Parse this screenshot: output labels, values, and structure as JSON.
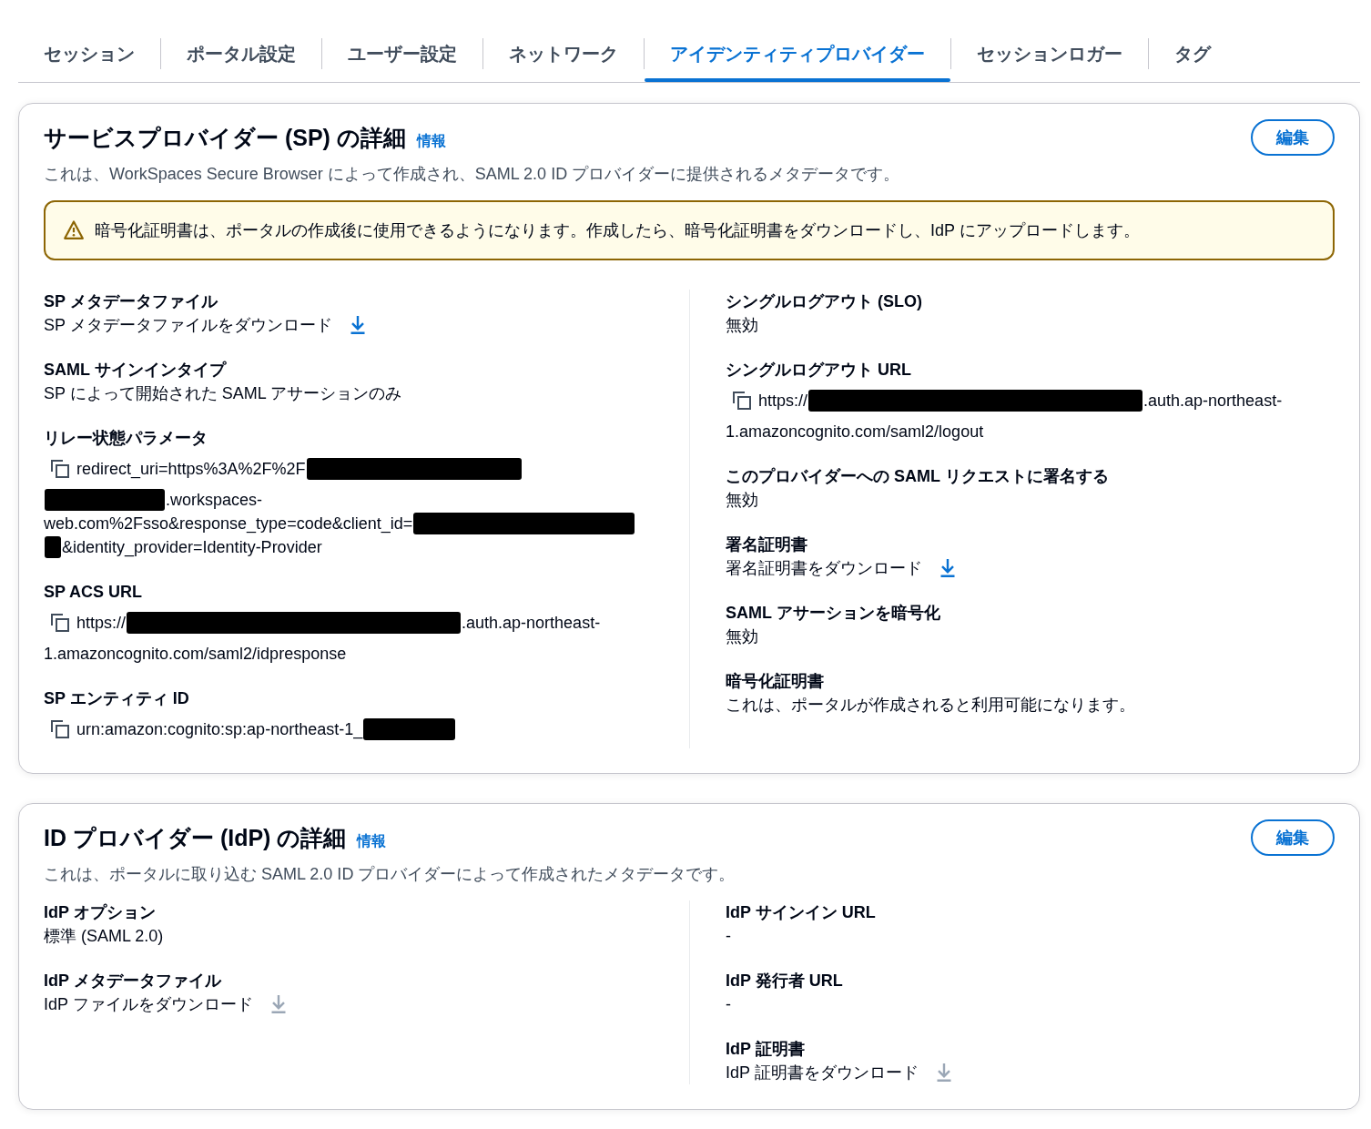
{
  "tabs": [
    {
      "label": "セッション",
      "selected": false
    },
    {
      "label": "ポータル設定",
      "selected": false
    },
    {
      "label": "ユーザー設定",
      "selected": false
    },
    {
      "label": "ネットワーク",
      "selected": false
    },
    {
      "label": "アイデンティティプロバイダー",
      "selected": true
    },
    {
      "label": "セッションロガー",
      "selected": false
    },
    {
      "label": "タグ",
      "selected": false
    }
  ],
  "sections": [
    {
      "title": "サービスプロバイダー (SP) の詳細",
      "info_link": "情報",
      "edit_button": "編集",
      "description": "これは、WorkSpaces Secure Browser によって作成され、SAML 2.0 ID プロバイダーに提供されるメタデータです。",
      "alert": {
        "text": "暗号化証明書は、ポータルの作成後に使用できるようになります。作成したら、暗号化証明書をダウンロードし、IdP にアップロードします。"
      },
      "columns": [
        [
          {
            "label": "SP メタデータファイル",
            "kind": "download",
            "value": "SP メタデータファイルをダウンロード",
            "disabled": false
          },
          {
            "label": "SAML サインインタイプ",
            "kind": "text",
            "value": "SP によって開始された SAML アサーションのみ"
          },
          {
            "label": "リレー状態パラメータ",
            "kind": "copy",
            "lines": [
              [
                {
                  "kind": "text",
                  "text": "redirect_uri=https%3A%2F%2F"
                },
                {
                  "kind": "redacted"
                }
              ],
              [
                {
                  "kind": "redacted"
                },
                {
                  "kind": "text",
                  "text": ".workspaces-"
                }
              ],
              [
                {
                  "kind": "text",
                  "text": "web.com%2Fsso&response_type=code&client_id="
                },
                {
                  "kind": "redacted"
                }
              ],
              [
                {
                  "kind": "redacted"
                },
                {
                  "kind": "text",
                  "text": "&identity_provider=Identity-Provider"
                }
              ]
            ]
          },
          {
            "label": "SP ACS URL",
            "kind": "copy",
            "lines": [
              [
                {
                  "kind": "text",
                  "text": "https://"
                },
                {
                  "kind": "redacted"
                },
                {
                  "kind": "text",
                  "text": ".auth.ap-northeast-"
                }
              ],
              [
                {
                  "kind": "text",
                  "text": "1.amazoncognito.com/saml2/idpresponse"
                }
              ]
            ]
          },
          {
            "label": "SP エンティティ ID",
            "kind": "copy",
            "lines": [
              [
                {
                  "kind": "text",
                  "text": "urn:amazon:cognito:sp:ap-northeast-1_"
                },
                {
                  "kind": "redacted"
                }
              ]
            ]
          }
        ],
        [
          {
            "label": "シングルログアウト (SLO)",
            "kind": "text",
            "value": "無効"
          },
          {
            "label": "シングルログアウト URL",
            "kind": "copy",
            "lines": [
              [
                {
                  "kind": "text",
                  "text": "https://"
                },
                {
                  "kind": "redacted"
                },
                {
                  "kind": "text",
                  "text": ".auth.ap-northeast-"
                }
              ],
              [
                {
                  "kind": "text",
                  "text": "1.amazoncognito.com/saml2/logout"
                }
              ]
            ]
          },
          {
            "label": "このプロバイダーへの SAML リクエストに署名する",
            "kind": "text",
            "value": "無効"
          },
          {
            "label": "署名証明書",
            "kind": "download",
            "value": "署名証明書をダウンロード",
            "disabled": false
          },
          {
            "label": "SAML アサーションを暗号化",
            "kind": "text",
            "value": "無効"
          },
          {
            "label": "暗号化証明書",
            "kind": "text",
            "value": "これは、ポータルが作成されると利用可能になります。"
          }
        ]
      ]
    },
    {
      "title": "ID プロバイダー (IdP) の詳細",
      "info_link": "情報",
      "edit_button": "編集",
      "description": "これは、ポータルに取り込む SAML 2.0 ID プロバイダーによって作成されたメタデータです。",
      "columns": [
        [
          {
            "label": "IdP オプション",
            "kind": "text",
            "value": "標準 (SAML 2.0)"
          },
          {
            "label": "IdP メタデータファイル",
            "kind": "download",
            "value": "IdP ファイルをダウンロード",
            "disabled": true
          }
        ],
        [
          {
            "label": "IdP サインイン URL",
            "kind": "text",
            "value": "-"
          },
          {
            "label": "IdP 発行者 URL",
            "kind": "text",
            "value": "-"
          },
          {
            "label": "IdP 証明書",
            "kind": "download",
            "value": "IdP 証明書をダウンロード",
            "disabled": true
          }
        ]
      ]
    }
  ]
}
